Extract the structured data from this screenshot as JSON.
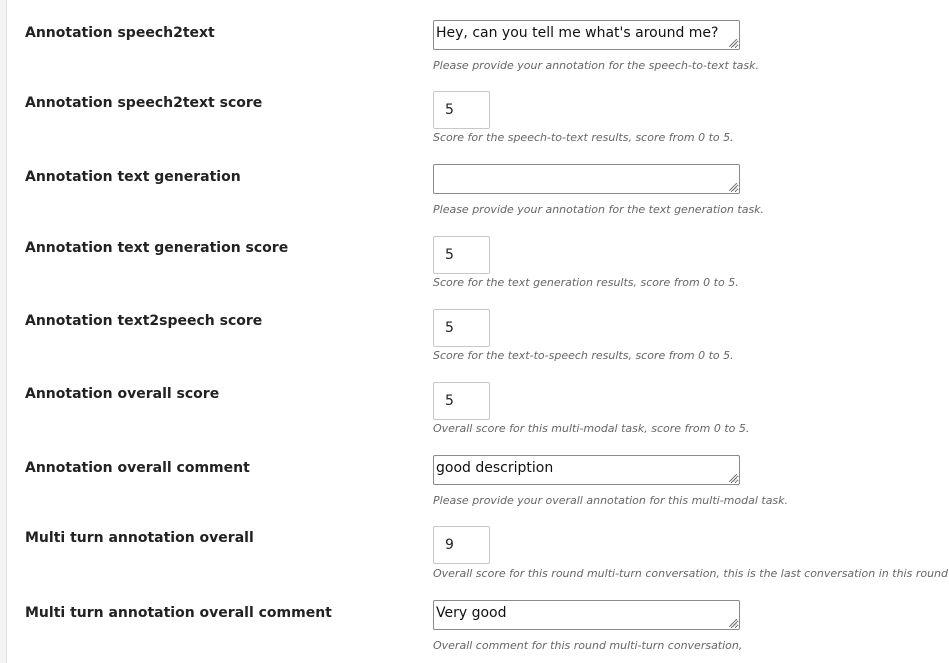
{
  "form": {
    "rows": [
      {
        "label": "Annotation speech2text",
        "value": "Hey, can you tell me what's around me?",
        "help": "Please provide your annotation for the speech-to-text task."
      },
      {
        "label": "Annotation speech2text score",
        "value": "5",
        "help": "Score for the speech-to-text results, score from 0 to 5."
      },
      {
        "label": "Annotation text generation",
        "value": "",
        "help": "Please provide your annotation for the text generation task."
      },
      {
        "label": "Annotation text generation score",
        "value": "5",
        "help": "Score for the text generation results, score from 0 to 5."
      },
      {
        "label": "Annotation text2speech score",
        "value": "5",
        "help": "Score for the text-to-speech results, score from 0 to 5."
      },
      {
        "label": "Annotation overall score",
        "value": "5",
        "help": "Overall score for this multi-modal task, score from 0 to 5."
      },
      {
        "label": "Annotation overall comment",
        "value": "good description",
        "help": "Please provide your overall annotation for this multi-modal task."
      },
      {
        "label": "Multi turn annotation overall",
        "value": "9",
        "help": "Overall score for this round multi-turn conversation, this is the last conversation in this round"
      },
      {
        "label": "Multi turn annotation overall comment",
        "value": "Very good",
        "help": "Overall comment for this round multi-turn conversation,"
      }
    ]
  }
}
